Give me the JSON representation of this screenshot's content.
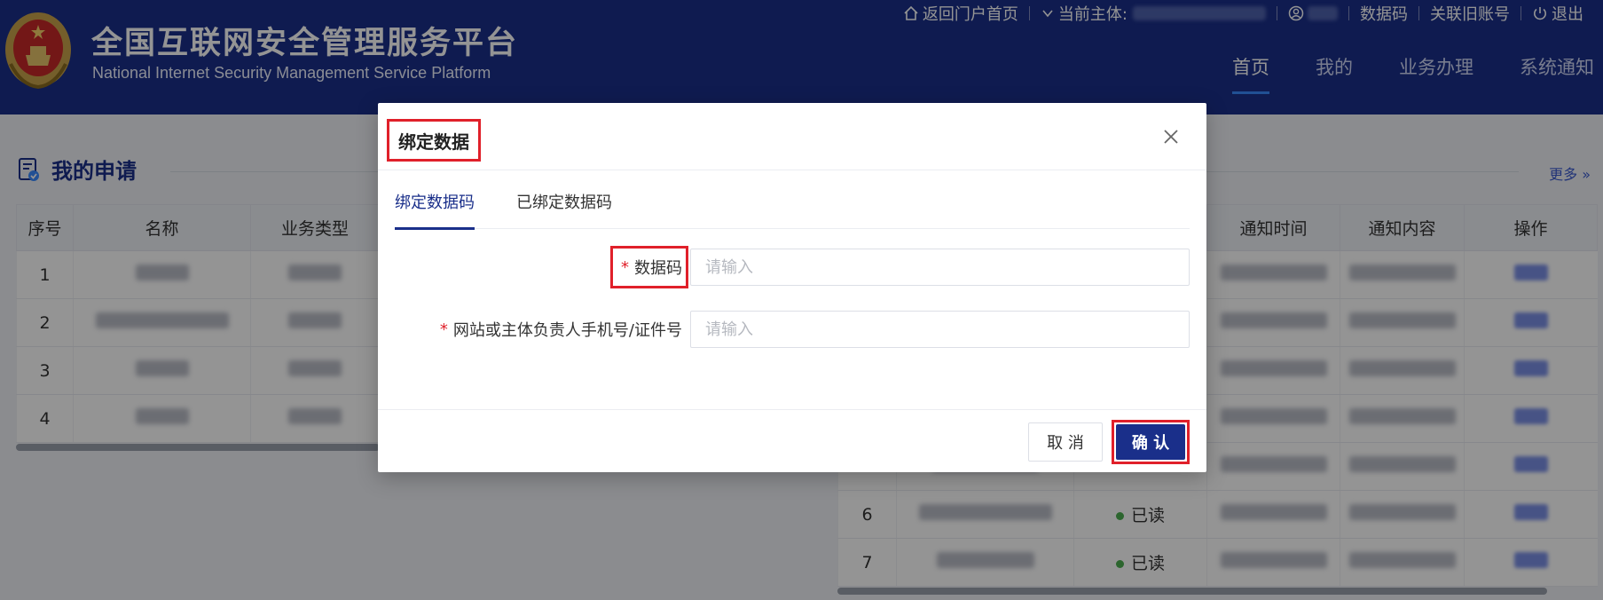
{
  "header": {
    "title": "全国互联网安全管理服务平台",
    "subtitle": "National Internet Security Management Service Platform",
    "topbar": {
      "home_link": "返回门户首页",
      "current_subject_label": "当前主体:",
      "data_code": "数据码",
      "link_old_account": "关联旧账号",
      "logout": "退出"
    },
    "nav": [
      "首页",
      "我的",
      "业务办理",
      "系统通知"
    ]
  },
  "main": {
    "section_title": "我的申请",
    "more": "更多 »",
    "left_table": {
      "columns": [
        "序号",
        "名称",
        "业务类型"
      ],
      "rows": [
        "1",
        "2",
        "3",
        "4"
      ]
    },
    "right_table": {
      "columns": [
        "通知时间",
        "通知内容",
        "操作"
      ],
      "rows": [
        {
          "index": "6",
          "status": "已读"
        },
        {
          "index": "7",
          "status": "已读"
        }
      ]
    }
  },
  "modal": {
    "title": "绑定数据",
    "tabs": [
      "绑定数据码",
      "已绑定数据码"
    ],
    "fields": [
      {
        "label": "数据码",
        "placeholder": "请输入",
        "required": true
      },
      {
        "label": "网站或主体负责人手机号/证件号",
        "placeholder": "请输入",
        "required": true
      }
    ],
    "buttons": {
      "cancel": "取 消",
      "confirm": "确 认"
    }
  },
  "colors": {
    "brand": "#1a2f8a",
    "highlight": "#e0202a",
    "required": "#e0202a"
  },
  "icons": [
    "emblem-icon",
    "home-icon",
    "chevron-down-icon",
    "user-icon",
    "power-icon",
    "document-check-icon",
    "close-icon"
  ]
}
